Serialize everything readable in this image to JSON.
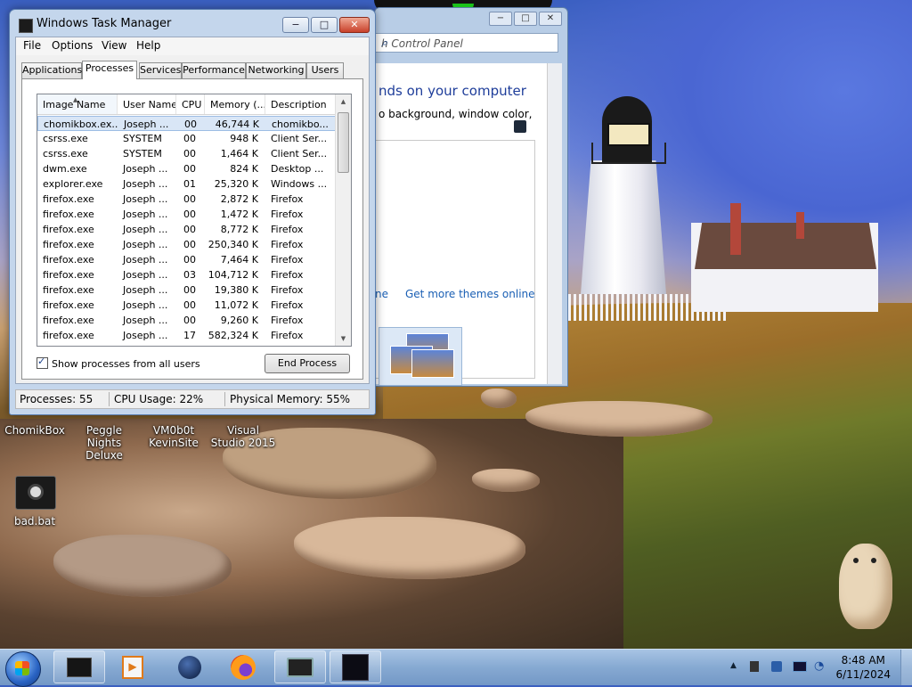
{
  "taskmgr": {
    "title": "Windows Task Manager",
    "controls": {
      "minimize": "−",
      "maximize": "□",
      "close": "✕"
    },
    "menu": [
      "File",
      "Options",
      "View",
      "Help"
    ],
    "tabs": [
      "Applications",
      "Processes",
      "Services",
      "Performance",
      "Networking",
      "Users"
    ],
    "active_tab": "Processes",
    "columns": [
      "Image Name",
      "User Name",
      "CPU",
      "Memory (...",
      "Description"
    ],
    "rows": [
      [
        "chomikbox.ex...",
        "Joseph ...",
        "00",
        "46,744 K",
        "chomikbo..."
      ],
      [
        "csrss.exe",
        "SYSTEM",
        "00",
        "948 K",
        "Client Ser..."
      ],
      [
        "csrss.exe",
        "SYSTEM",
        "00",
        "1,464 K",
        "Client Ser..."
      ],
      [
        "dwm.exe",
        "Joseph ...",
        "00",
        "824 K",
        "Desktop ..."
      ],
      [
        "explorer.exe",
        "Joseph ...",
        "01",
        "25,320 K",
        "Windows ..."
      ],
      [
        "firefox.exe",
        "Joseph ...",
        "00",
        "2,872 K",
        "Firefox"
      ],
      [
        "firefox.exe",
        "Joseph ...",
        "00",
        "1,472 K",
        "Firefox"
      ],
      [
        "firefox.exe",
        "Joseph ...",
        "00",
        "8,772 K",
        "Firefox"
      ],
      [
        "firefox.exe",
        "Joseph ...",
        "00",
        "250,340 K",
        "Firefox"
      ],
      [
        "firefox.exe",
        "Joseph ...",
        "00",
        "7,464 K",
        "Firefox"
      ],
      [
        "firefox.exe",
        "Joseph ...",
        "03",
        "104,712 K",
        "Firefox"
      ],
      [
        "firefox.exe",
        "Joseph ...",
        "00",
        "19,380 K",
        "Firefox"
      ],
      [
        "firefox.exe",
        "Joseph ...",
        "00",
        "11,072 K",
        "Firefox"
      ],
      [
        "firefox.exe",
        "Joseph ...",
        "00",
        "9,260 K",
        "Firefox"
      ],
      [
        "firefox.exe",
        "Joseph ...",
        "17",
        "582,324 K",
        "Firefox"
      ]
    ],
    "selected_row": 0,
    "show_all_label": "Show processes from all users",
    "show_all_checked": true,
    "end_process_label": "End Process",
    "status": {
      "processes": "Processes: 55",
      "cpu": "CPU Usage: 22%",
      "memory": "Physical Memory: 55%"
    }
  },
  "control_panel": {
    "search_placeholder": "h Control Panel",
    "heading": "nds on your computer",
    "subtext": "o background, window color,",
    "link_left": "ne",
    "link_right": "Get more themes online"
  },
  "desktop_icons": [
    {
      "label": "ChomikBox",
      "icon": "chomikbox-icon"
    },
    {
      "label": "Peggle Nights Deluxe",
      "icon": "peggle-icon"
    },
    {
      "label": "VM0b0t KevinSite",
      "icon": "vm-icon"
    },
    {
      "label": "Visual Studio 2015",
      "icon": "visual-studio-icon"
    },
    {
      "label": "bad.bat",
      "icon": "batch-file-icon"
    }
  ],
  "taskbar": {
    "buttons": [
      "taskmgr-icon",
      "media-player-icon",
      "globe-icon",
      "firefox-icon",
      "display-icon",
      "monitor-app-icon"
    ],
    "clock_time": "8:48 AM",
    "clock_date": "6/11/2024",
    "tray_icons": [
      "show-hidden-icon",
      "network-device-icon",
      "remote-icon",
      "display-tray-icon",
      "volume-icon"
    ]
  },
  "colors": {
    "window_frame": "#c4d6ec",
    "link": "#1a5fb4",
    "selection": "#d9e6f6",
    "taskbar": "#86a9d2"
  }
}
